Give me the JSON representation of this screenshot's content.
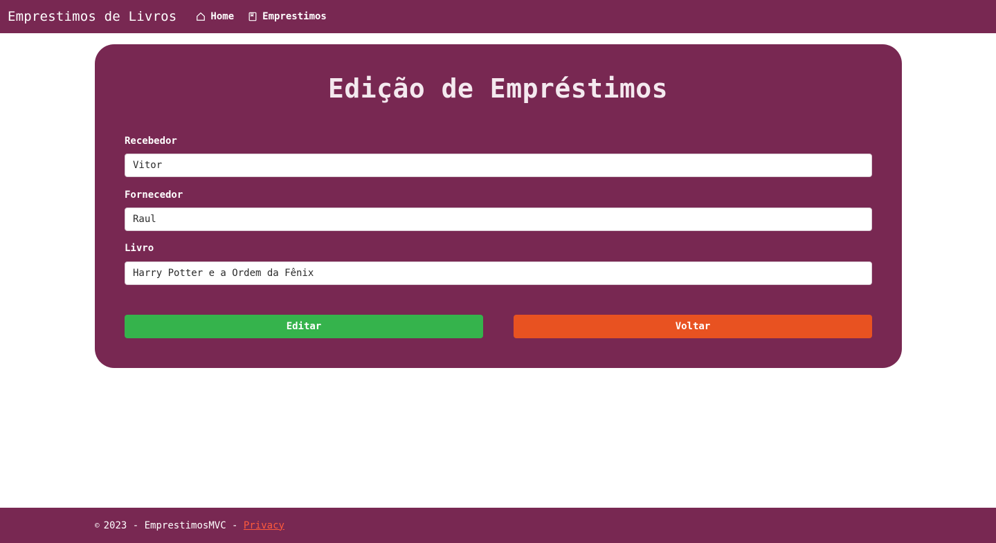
{
  "navbar": {
    "brand": "Emprestimos de Livros",
    "links": [
      {
        "label": "Home",
        "icon": "house-icon"
      },
      {
        "label": "Emprestimos",
        "icon": "notebook-icon"
      }
    ]
  },
  "form": {
    "title": "Edição de Empréstimos",
    "fields": [
      {
        "label": "Recebedor",
        "value": "Vitor"
      },
      {
        "label": "Fornecedor",
        "value": "Raul"
      },
      {
        "label": "Livro",
        "value": "Harry Potter e a Ordem da Fênix"
      }
    ],
    "buttons": {
      "edit": "Editar",
      "back": "Voltar"
    }
  },
  "footer": {
    "copyright_symbol": "©",
    "text": "2023 - EmprestimosMVC - ",
    "privacy_link": "Privacy"
  },
  "colors": {
    "primary": "#782852",
    "edit_button": "#35b34c",
    "back_button": "#e85221",
    "link": "#ff5a3c"
  }
}
